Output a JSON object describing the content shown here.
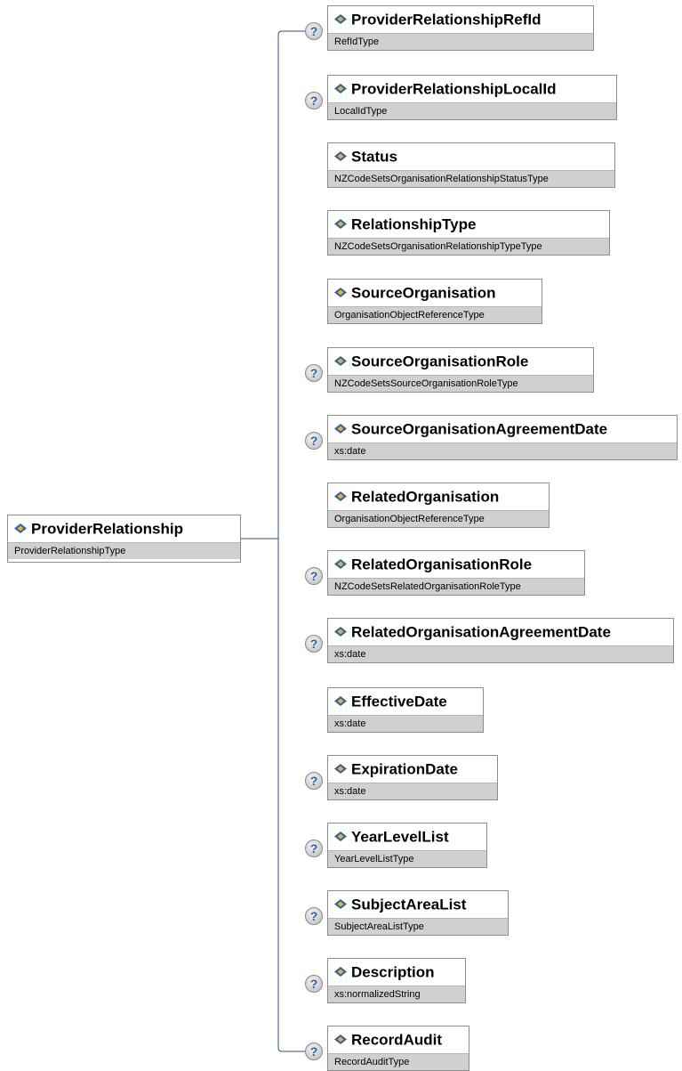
{
  "root": {
    "name": "ProviderRelationship",
    "type": "ProviderRelationshipType"
  },
  "elements": [
    {
      "name": "ProviderRelationshipRefId",
      "type": "RefIdType",
      "optional": true
    },
    {
      "name": "ProviderRelationshipLocalId",
      "type": "LocalIdType",
      "optional": true
    },
    {
      "name": "Status",
      "type": "NZCodeSetsOrganisationRelationshipStatusType",
      "optional": false
    },
    {
      "name": "RelationshipType",
      "type": "NZCodeSetsOrganisationRelationshipTypeType",
      "optional": false
    },
    {
      "name": "SourceOrganisation",
      "type": "OrganisationObjectReferenceType",
      "optional": false
    },
    {
      "name": "SourceOrganisationRole",
      "type": "NZCodeSetsSourceOrganisationRoleType",
      "optional": true
    },
    {
      "name": "SourceOrganisationAgreementDate",
      "type": "xs:date",
      "optional": true
    },
    {
      "name": "RelatedOrganisation",
      "type": "OrganisationObjectReferenceType",
      "optional": false
    },
    {
      "name": "RelatedOrganisationRole",
      "type": "NZCodeSetsRelatedOrganisationRoleType",
      "optional": true
    },
    {
      "name": "RelatedOrganisationAgreementDate",
      "type": "xs:date",
      "optional": true
    },
    {
      "name": "EffectiveDate",
      "type": "xs:date",
      "optional": false
    },
    {
      "name": "ExpirationDate",
      "type": "xs:date",
      "optional": true
    },
    {
      "name": "YearLevelList",
      "type": "YearLevelListType",
      "optional": true
    },
    {
      "name": "SubjectAreaList",
      "type": "SubjectAreaListType",
      "optional": true
    },
    {
      "name": "Description",
      "type": "xs:normalizedString",
      "optional": true
    },
    {
      "name": "RecordAudit",
      "type": "RecordAuditType",
      "optional": true
    }
  ],
  "optional_marker": "?",
  "colors": {
    "border": "#8c8c8c",
    "type_band": "#d0d0d0",
    "connector": "#2f4f80",
    "icon_blue": "#2f63a6",
    "icon_yellow": "#f2b01e"
  }
}
